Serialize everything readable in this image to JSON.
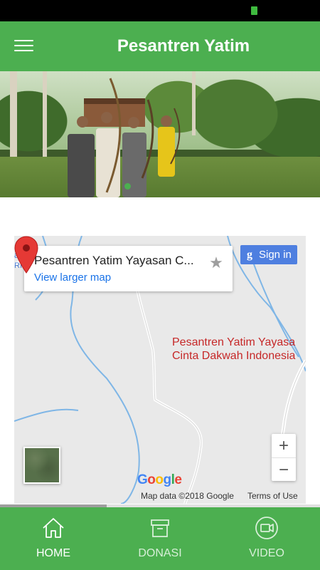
{
  "app": {
    "title": "Pesantren Yatim"
  },
  "map": {
    "place_name": "Pesantren Yatim Yayasan C...",
    "view_larger": "View larger map",
    "signin_label": "Sign in",
    "marker_label_line1": "Pesantren Yatim Yayasa",
    "marker_label_line2": "Cinta Dakwah Indonesia",
    "zoom_in": "+",
    "zoom_out": "−",
    "google_logo": [
      "G",
      "o",
      "o",
      "g",
      "l",
      "e"
    ],
    "map_data": "Map data ©2018 Google",
    "terms": "Terms of Use"
  },
  "carousel": {
    "current_page": 1
  },
  "nav": {
    "items": [
      {
        "label": "HOME",
        "icon": "home-icon",
        "active": true
      },
      {
        "label": "DONASI",
        "icon": "archive-box-icon",
        "active": false
      },
      {
        "label": "VIDEO",
        "icon": "video-camera-icon",
        "active": false
      }
    ]
  },
  "colors": {
    "primary": "#4caf50",
    "status_bar": "#000000",
    "marker": "#e53935",
    "link": "#1a73e8",
    "signin": "#4e7fe0",
    "google": [
      "#4285f4",
      "#ea4335",
      "#fbbc05",
      "#4285f4",
      "#34a853",
      "#ea4335"
    ]
  }
}
